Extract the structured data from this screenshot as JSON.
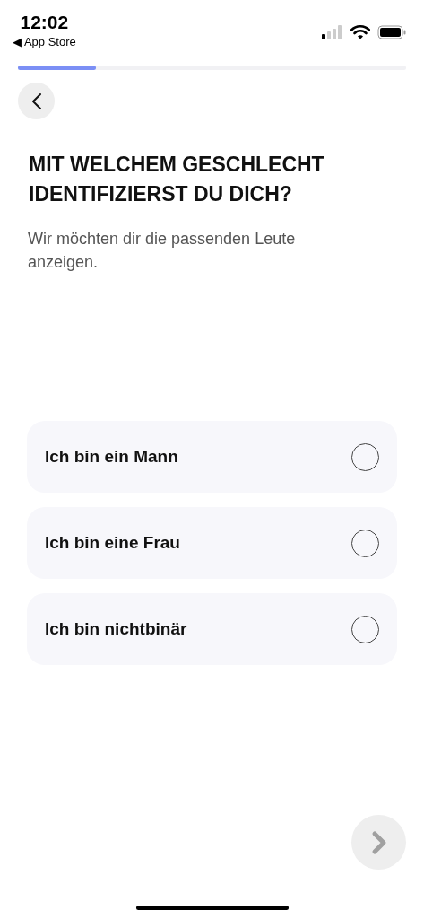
{
  "status_bar": {
    "time": "12:02",
    "back_label": "◀ App Store"
  },
  "progress": {
    "level": 0.2
  },
  "title": "MIT WELCHEM GESCHLECHT IDENTIFIZIERST DU DICH?",
  "subtitle": "Wir möchten dir die passenden Leute anzeigen.",
  "options": [
    {
      "label": "Ich bin ein Mann",
      "selected": false
    },
    {
      "label": "Ich bin eine Frau",
      "selected": false
    },
    {
      "label": "Ich bin nichtbinär",
      "selected": false
    }
  ],
  "next_button": {
    "disabled": true
  }
}
